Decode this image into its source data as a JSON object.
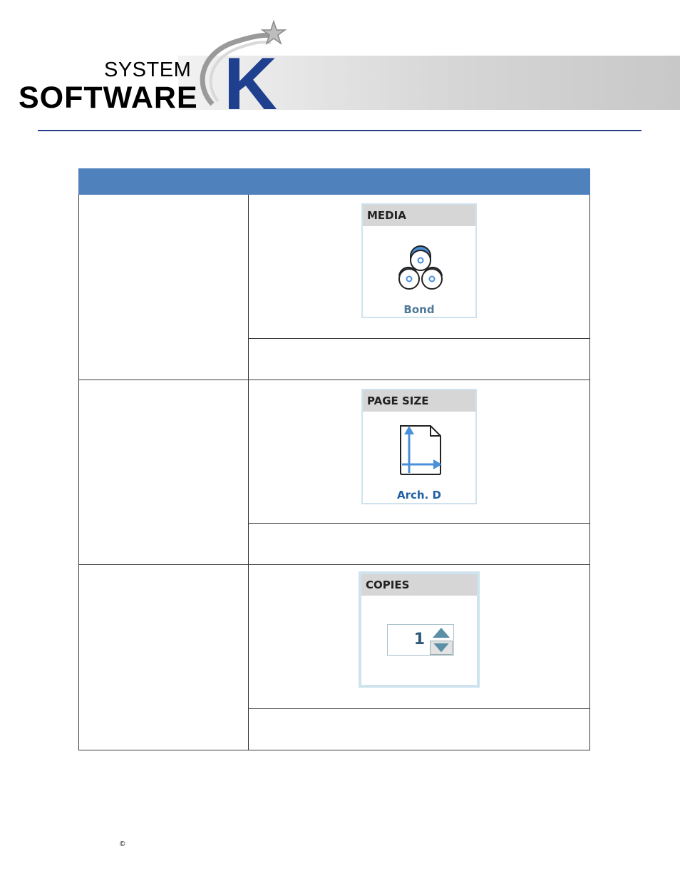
{
  "header": {
    "logo_line1": "SYSTEM",
    "logo_line2": "SOFTWARE",
    "logo_letter": "K"
  },
  "table": {
    "headers": [
      "",
      ""
    ],
    "rows": [
      {
        "panel_title": "MEDIA",
        "panel_value": "Bond",
        "icon": "media-rolls-icon"
      },
      {
        "panel_title": "PAGE SIZE",
        "panel_value": "Arch. D",
        "icon": "page-size-icon"
      },
      {
        "panel_title": "COPIES",
        "panel_value": "1",
        "icon": "spinner-arrows-icon"
      }
    ]
  },
  "footer": {
    "copyright_symbol": "©"
  },
  "colors": {
    "header_rule": "#2b3d8f",
    "table_header": "#4f81bd",
    "accent_blue": "#4a90d9",
    "logo_k": "#1f3f8f"
  }
}
